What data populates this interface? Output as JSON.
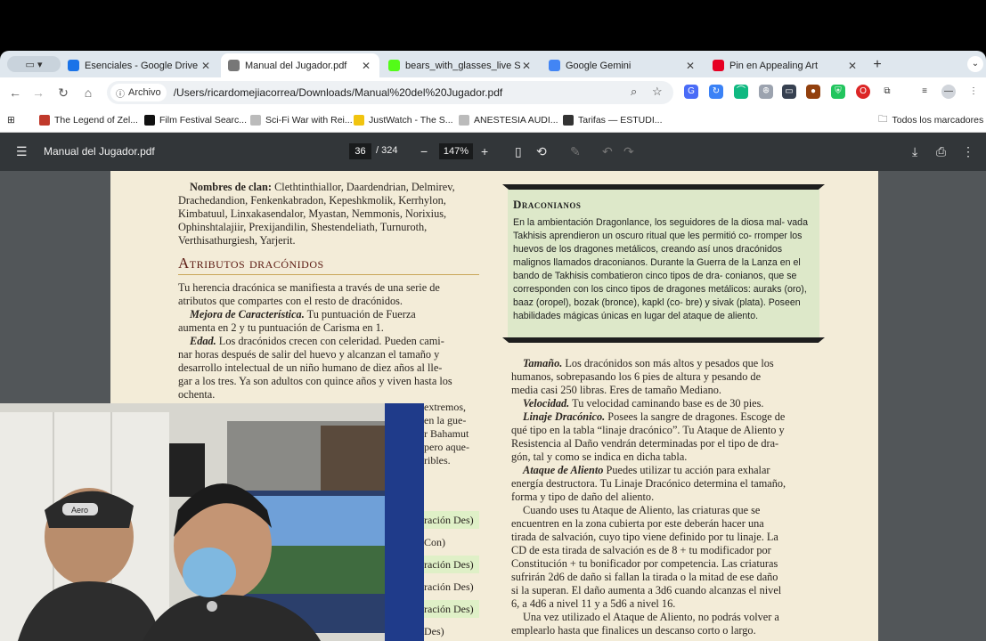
{
  "tabs": [
    {
      "title": "Esenciales - Google Drive",
      "icon": "google-drive-icon",
      "color": "#1a73e8"
    },
    {
      "title": "Manual del Jugador.pdf",
      "icon": "globe-icon",
      "color": "#777777"
    },
    {
      "title": "bears_with_glasses_live Stre",
      "icon": "kick-icon",
      "color": "#53fc18"
    },
    {
      "title": "Google Gemini",
      "icon": "gemini-icon",
      "color": "#4285f4"
    },
    {
      "title": "Pin en Appealing Art",
      "icon": "pinterest-icon",
      "color": "#e60023"
    }
  ],
  "omnibox": {
    "chip": "Archivo",
    "url": "/Users/ricardomejiacorrea/Downloads/Manual%20del%20Jugador.pdf"
  },
  "bookmarks": [
    {
      "label": "The Legend of Zel...",
      "color": "#c0392b"
    },
    {
      "label": "Film Festival Searc...",
      "color": "#111111"
    },
    {
      "label": "Sci-Fi War with Rei...",
      "color": "#bbbbbb"
    },
    {
      "label": "JustWatch - The S...",
      "color": "#f1c40f"
    },
    {
      "label": "ANESTESIA AUDI...",
      "color": "#bbbbbb"
    },
    {
      "label": "Tarifas — ESTUDI...",
      "color": "#333333"
    }
  ],
  "bookmarks_folder": "Todos los marcadores",
  "pdf": {
    "title": "Manual del Jugador.pdf",
    "page": "36",
    "total": "/ 324",
    "zoom": "147%"
  },
  "left_col": {
    "clan_lines": [
      {
        "b": "Nombres de clan:",
        "t": " Clethtinthiallor, Daardendrian, Delmirev,"
      },
      {
        "b": "",
        "t": "Drachedandion, Fenkenkabradon, Kepeshkmolik, Kerrhylon,"
      },
      {
        "b": "",
        "t": "Kimbatuul, Linxakasendalor, Myastan, Nemmonis, Norixius,"
      },
      {
        "b": "",
        "t": "Ophinshtalajiir, Prexijandilin, Shestendeliath, Turnuroth,"
      },
      {
        "b": "",
        "t": "Verthisathurgiesh, Yarjerit."
      }
    ],
    "heading": "Atributos dracónidos",
    "body_lines": [
      {
        "b": "",
        "t": "Tu herencia dracónica se manifiesta a través de una serie de"
      },
      {
        "b": "",
        "t": "atributos que compartes con el resto de dracónidos."
      },
      {
        "b": "Mejora de Característica.",
        "t": " Tu puntuación de Fuerza"
      },
      {
        "b": "",
        "t": "aumenta en 2 y tu puntuación de Carisma en 1."
      },
      {
        "b": "Edad.",
        "t": " Los dracónidos crecen con celeridad. Pueden cami-"
      },
      {
        "b": "",
        "t": "nar horas después de salir del huevo y alcanzan el tamaño y"
      },
      {
        "b": "",
        "t": "desarrollo intelectual de un niño humano de diez años al lle-"
      },
      {
        "b": "",
        "t": "gar a los tres. Ya son adultos con quince años y viven hasta los"
      },
      {
        "b": "",
        "t": "ochenta."
      }
    ],
    "partial_lines": [
      "extremos,",
      "en la gue-",
      "r Bahamut",
      "pero aque-",
      "ribles."
    ],
    "table_partials": [
      "ración Des)",
      "Con)",
      "ración Des)",
      "ración Des)",
      "ración Des)",
      "Des)"
    ]
  },
  "sidebar": {
    "title": "Draconianos",
    "text": "En la ambientación Dragonlance, los seguidores de la diosa mal- vada Takhisis aprendieron un oscuro ritual que les permitió co- rromper los huevos de los dragones metálicos, creando así unos dracónidos malignos llamados draconianos. Durante la Guerra de la Lanza en el bando de Takhisis combatieron cinco tipos de dra- conianos, que se corresponden con los cinco tipos de dragones metálicos: auraks (oro), baaz (oropel), bozak (bronce), kapkl (co- bre) y sivak (plata). Poseen habilidades mágicas únicas en lugar del ataque de aliento."
  },
  "right_col": [
    {
      "b": "Tamaño.",
      "t": " Los dracónidos son más altos y pesados que los",
      "i": true
    },
    {
      "b": "",
      "t": "humanos, sobrepasando los 6 pies de altura y pesando de"
    },
    {
      "b": "",
      "t": "media casi 250 libras. Eres de tamaño Mediano."
    },
    {
      "b": "Velocidad.",
      "t": " Tu velocidad caminando base es de 30 pies.",
      "i": true
    },
    {
      "b": "Linaje Dracónico.",
      "t": " Posees la sangre de dragones. Escoge de",
      "i": true
    },
    {
      "b": "",
      "t": "qué tipo en la tabla “linaje dracónico”. Tu Ataque de Aliento y"
    },
    {
      "b": "",
      "t": "Resistencia al Daño vendrán determinadas por el tipo de dra-"
    },
    {
      "b": "",
      "t": "gón, tal y como se indica en dicha tabla."
    },
    {
      "b": "Ataque de Aliento",
      "t": " Puedes utilizar tu acción para exhalar",
      "i": true
    },
    {
      "b": "",
      "t": "energía destructora. Tu Linaje Dracónico determina el tamaño,"
    },
    {
      "b": "",
      "t": "forma y tipo de daño del aliento."
    },
    {
      "b": "",
      "t": "Cuando uses tu Ataque de Aliento, las criaturas que se",
      "i": true
    },
    {
      "b": "",
      "t": "encuentren en la zona cubierta por este deberán hacer una"
    },
    {
      "b": "",
      "t": "tirada de salvación, cuyo tipo viene definido por tu linaje. La"
    },
    {
      "b": "",
      "t": "CD de esta tirada de salvación es de 8 + tu modificador por"
    },
    {
      "b": "",
      "t": "Constitución + tu bonificador por competencia. Las criaturas"
    },
    {
      "b": "",
      "t": "sufrirán 2d6 de daño si fallan la tirada o la mitad de ese daño"
    },
    {
      "b": "",
      "t": "si la superan. El daño aumenta a 3d6 cuando alcanzas el nivel"
    },
    {
      "b": "",
      "t": "6, a 4d6 a nivel 11 y a 5d6 a nivel 16."
    },
    {
      "b": "",
      "t": "Una vez utilizado el Ataque de Aliento, no podrás volver a",
      "i": true
    },
    {
      "b": "",
      "t": "emplearlo hasta que finalices un descanso corto o largo."
    }
  ],
  "webcam": {
    "cap_text": "Aero"
  }
}
